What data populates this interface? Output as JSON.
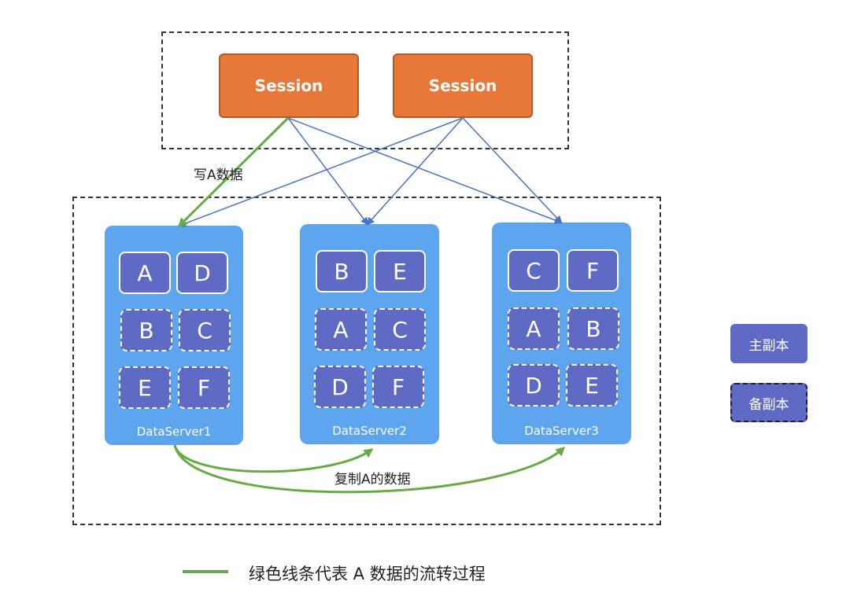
{
  "sessions": [
    {
      "label": "Session"
    },
    {
      "label": "Session"
    }
  ],
  "servers": [
    {
      "label": "DataServer1",
      "replicas": [
        {
          "letter": "A",
          "kind": "primary"
        },
        {
          "letter": "D",
          "kind": "primary"
        },
        {
          "letter": "B",
          "kind": "backup"
        },
        {
          "letter": "C",
          "kind": "backup"
        },
        {
          "letter": "E",
          "kind": "backup"
        },
        {
          "letter": "F",
          "kind": "backup"
        }
      ]
    },
    {
      "label": "DataServer2",
      "replicas": [
        {
          "letter": "B",
          "kind": "primary"
        },
        {
          "letter": "E",
          "kind": "primary"
        },
        {
          "letter": "A",
          "kind": "backup"
        },
        {
          "letter": "C",
          "kind": "backup"
        },
        {
          "letter": "D",
          "kind": "backup"
        },
        {
          "letter": "F",
          "kind": "backup"
        }
      ]
    },
    {
      "label": "DataServer3",
      "replicas": [
        {
          "letter": "C",
          "kind": "primary"
        },
        {
          "letter": "F",
          "kind": "primary"
        },
        {
          "letter": "A",
          "kind": "backup"
        },
        {
          "letter": "B",
          "kind": "backup"
        },
        {
          "letter": "D",
          "kind": "backup"
        },
        {
          "letter": "E",
          "kind": "backup"
        }
      ]
    }
  ],
  "labels": {
    "write": "写A数据",
    "copy": "复制A的数据"
  },
  "legend": {
    "primary": "主副本",
    "backup": "备副本",
    "green_line": "绿色线条代表 A 数据的流转过程"
  },
  "colors": {
    "session": "#e8783a",
    "server": "#5da5ef",
    "replica": "#5f6ac4",
    "data_flow": "#6aaa46",
    "route": "#4a72c4"
  }
}
